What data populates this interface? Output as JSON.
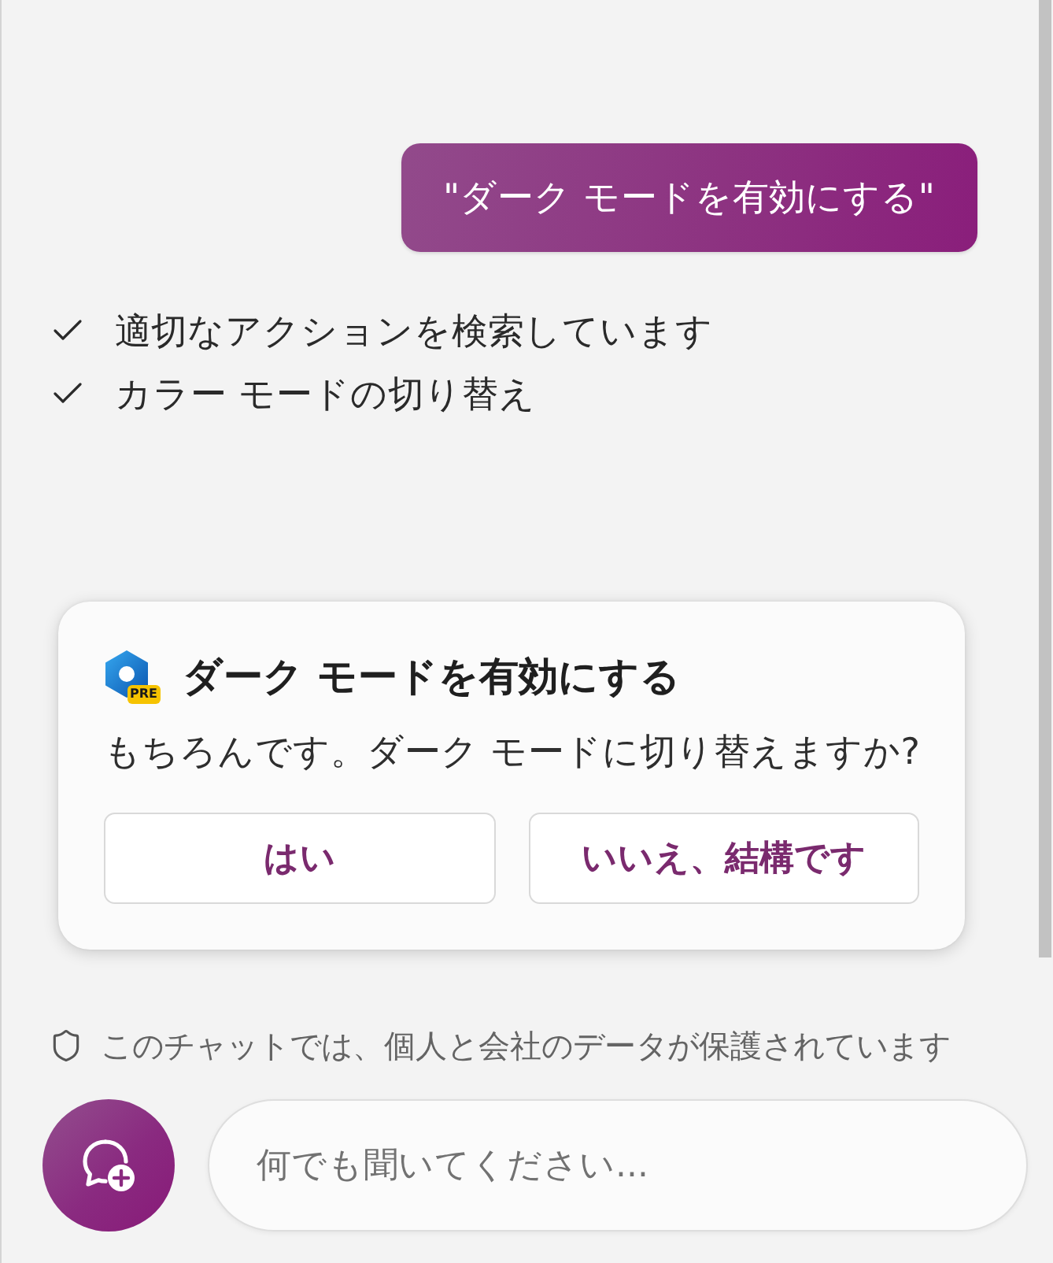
{
  "user_message": {
    "text": "\"ダーク モードを有効にする\""
  },
  "progress_steps": [
    {
      "text": "適切なアクションを検索しています",
      "done": true
    },
    {
      "text": "カラー モードの切り替え",
      "done": true
    }
  ],
  "action_card": {
    "title": "ダーク モードを有効にする",
    "badge": "PRE",
    "message": "もちろんです。ダーク モードに切り替えますか?",
    "buttons": [
      {
        "label": "はい"
      },
      {
        "label": "いいえ、結構です"
      }
    ]
  },
  "privacy_notice": {
    "text": "このチャットでは、個人と会社のデータが保護されています"
  },
  "composer": {
    "placeholder": "何でも聞いてください..."
  }
}
